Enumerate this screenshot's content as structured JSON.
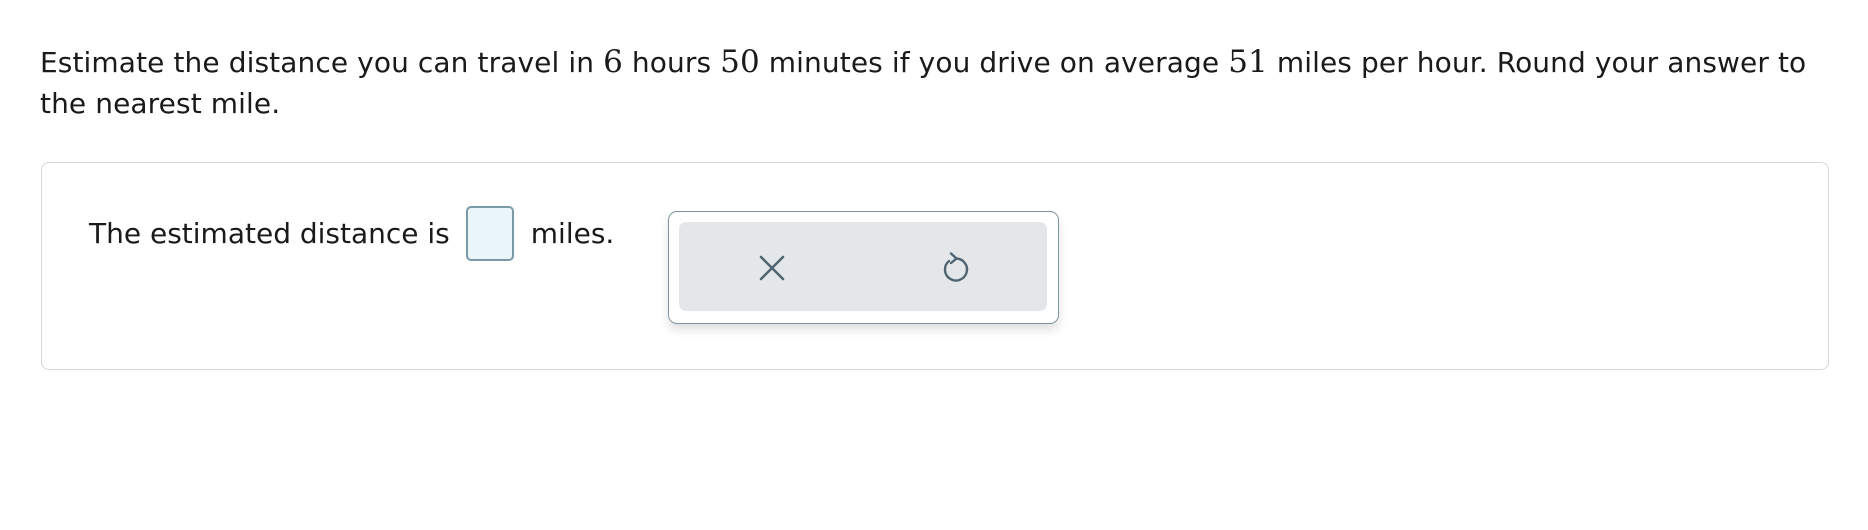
{
  "question": {
    "part1": "Estimate the distance you can travel in ",
    "hours_value": "6",
    "part2": " hours ",
    "minutes_value": "50",
    "part3": " minutes if you drive on average ",
    "speed_value": "51",
    "part4": " miles per hour. Round your answer to the nearest mile."
  },
  "answer": {
    "prefix": "The estimated distance is",
    "value": "",
    "suffix": "miles."
  },
  "tools": {
    "clear_icon": "x-icon",
    "undo_icon": "undo-icon"
  },
  "colors": {
    "input_bg": "#eaf5f9",
    "input_border": "#7a9aa8",
    "toolbar_bg": "#e3e7e9",
    "icon_color": "#4f6470"
  }
}
